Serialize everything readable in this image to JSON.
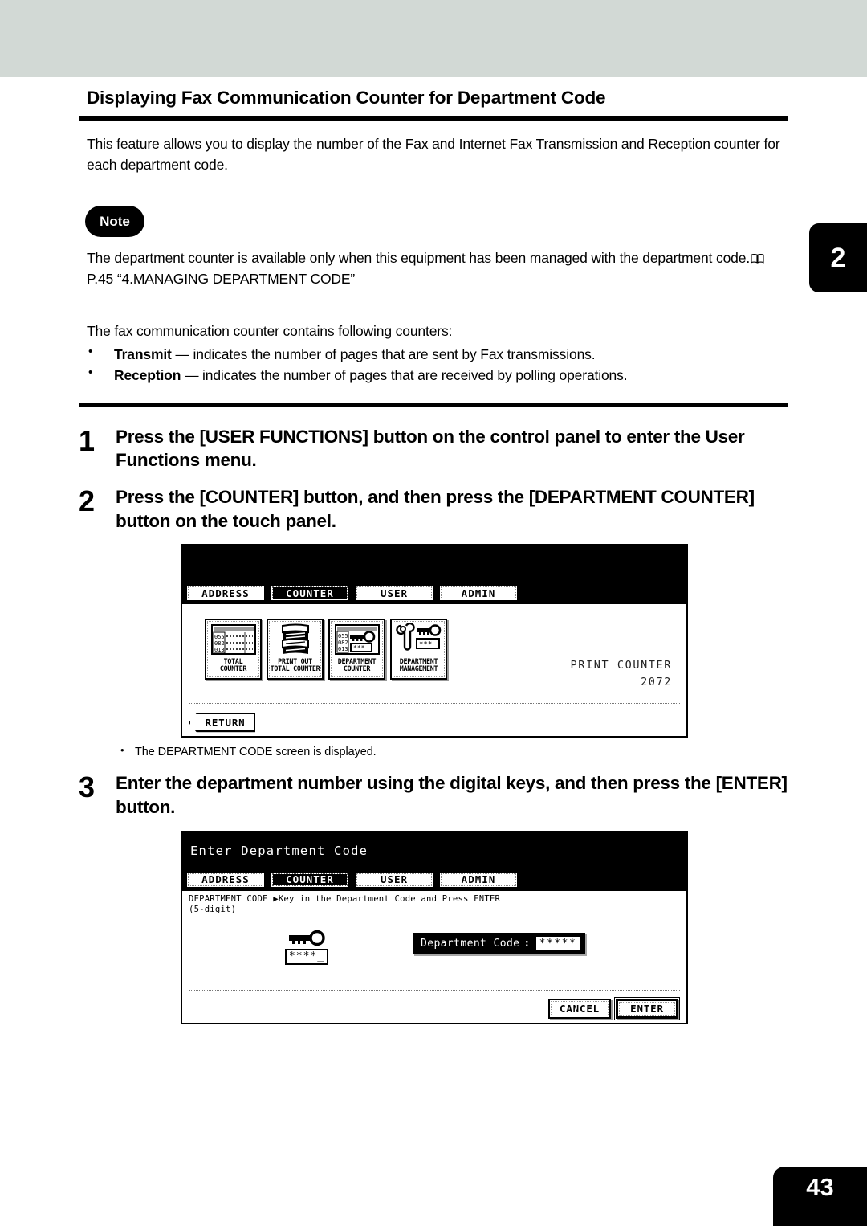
{
  "page": {
    "chapter_tab": "2",
    "page_number": "43",
    "title": "Displaying Fax Communication Counter for Department Code",
    "intro": "This feature allows you to display the number of the Fax and Internet Fax Transmission and Reception counter for each department code."
  },
  "note": {
    "badge": "Note",
    "text_before_icon": "The department counter is available only when this equipment has been managed with the department code.",
    "icon": "book-icon",
    "reference": "P.45 “4.MANAGING DEPARTMENT CODE”"
  },
  "counters": {
    "lead": "The fax communication counter contains following counters:",
    "items": [
      {
        "term": "Transmit",
        "dash": " — ",
        "desc": "indicates the number of pages that are sent by Fax transmissions."
      },
      {
        "term": "Reception",
        "dash": " — ",
        "desc": "indicates the number of pages that are received by polling operations."
      }
    ]
  },
  "steps": [
    {
      "num": "1",
      "text": "Press the [USER FUNCTIONS] button on the control panel to enter the User Functions menu."
    },
    {
      "num": "2",
      "text": "Press the [COUNTER] button, and then press the [DEPARTMENT COUNTER] button on the touch panel."
    },
    {
      "num": "3",
      "text": "Enter the department number using the digital keys, and then press the [ENTER] button."
    }
  ],
  "step2_note": "The DEPARTMENT CODE screen is displayed.",
  "panel1": {
    "title": "",
    "tabs": [
      {
        "label": "ADDRESS",
        "selected": false
      },
      {
        "label": "COUNTER",
        "selected": true
      },
      {
        "label": "USER",
        "selected": false
      },
      {
        "label": "ADMIN",
        "selected": false
      }
    ],
    "icons": [
      {
        "label": "TOTAL\nCOUNTER",
        "icon": "total-counter-icon"
      },
      {
        "label": "PRINT OUT\nTOTAL COUNTER",
        "icon": "print-out-total-counter-icon"
      },
      {
        "label": "DEPARTMENT\nCOUNTER",
        "icon": "department-counter-icon"
      },
      {
        "label": "DEPARTMENT\nMANAGEMENT",
        "icon": "department-management-icon"
      }
    ],
    "print_counter_label": "PRINT COUNTER",
    "print_counter_value": "2072",
    "return_label": "RETURN"
  },
  "panel2": {
    "title": "Enter Department Code",
    "tabs": [
      {
        "label": "ADDRESS",
        "selected": false
      },
      {
        "label": "COUNTER",
        "selected": true
      },
      {
        "label": "USER",
        "selected": false
      },
      {
        "label": "ADMIN",
        "selected": false
      }
    ],
    "prompt": "DEPARTMENT CODE  ▶Key in the Department Code and Press ENTER\n(5-digit)",
    "key_icon": "key-icon",
    "key_code": "****_",
    "field_label": "Department Code",
    "field_colon": ":",
    "field_value": "*****",
    "cancel_label": "CANCEL",
    "enter_label": "ENTER"
  },
  "colors": {
    "top_band": "#d2d9d5",
    "tab_black": "#000000",
    "paper": "#ffffff"
  }
}
